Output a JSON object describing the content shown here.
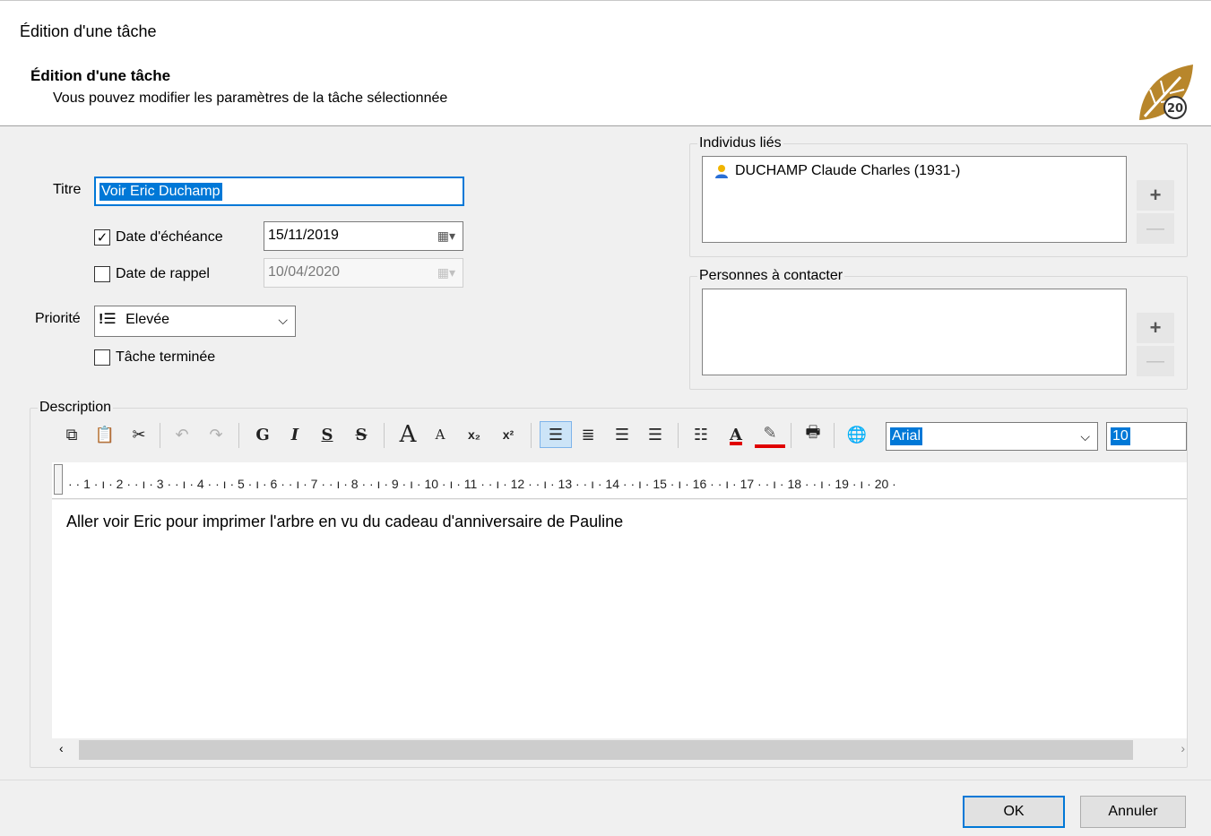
{
  "window": {
    "title": "Édition d'une tâche"
  },
  "header": {
    "title": "Édition d'une tâche",
    "subtitle": "Vous pouvez modifier les paramètres de la tâche sélectionnée",
    "logo_text": "20"
  },
  "form": {
    "title_label": "Titre",
    "title_value": "Voir Eric Duchamp",
    "due_date_label": "Date d'échéance",
    "due_date_checked": true,
    "due_date_value": "15/11/2019",
    "reminder_label": "Date de rappel",
    "reminder_checked": false,
    "reminder_value": "10/04/2020",
    "priority_label": "Priorité",
    "priority_icon": "!☰",
    "priority_value": "Elevée",
    "done_label": "Tâche terminée",
    "done_checked": false
  },
  "linked": {
    "title": "Individus liés",
    "items": [
      "DUCHAMP Claude Charles (1931-)"
    ],
    "add": "+",
    "remove": "—"
  },
  "contacts": {
    "title": "Personnes à contacter",
    "add": "+",
    "remove": "—"
  },
  "description": {
    "title": "Description",
    "font": "Arial",
    "size": "10",
    "text": "Aller voir Eric pour imprimer l'arbre en vu du cadeau d'anniversaire de Pauline",
    "ruler": "· · 1 · ı · 2 · · ı · 3 · · ı · 4 · · ı · 5 · ı · 6 · · ı · 7 · · ı · 8 · · ı · 9 · ı · 10 · ı · 11 · · ı · 12 · · ı · 13 · · ı · 14 · · ı · 15 · ı · 16 · · ı · 17 · · ı · 18 · · ı · 19 · ı · 20 ·"
  },
  "toolbar": {
    "bold": "G",
    "italic": "I",
    "underline": "S",
    "strike": "S",
    "grow": "A",
    "shrink": "A",
    "subscript": "x₂",
    "superscript": "x²"
  },
  "buttons": {
    "ok": "OK",
    "cancel": "Annuler"
  }
}
